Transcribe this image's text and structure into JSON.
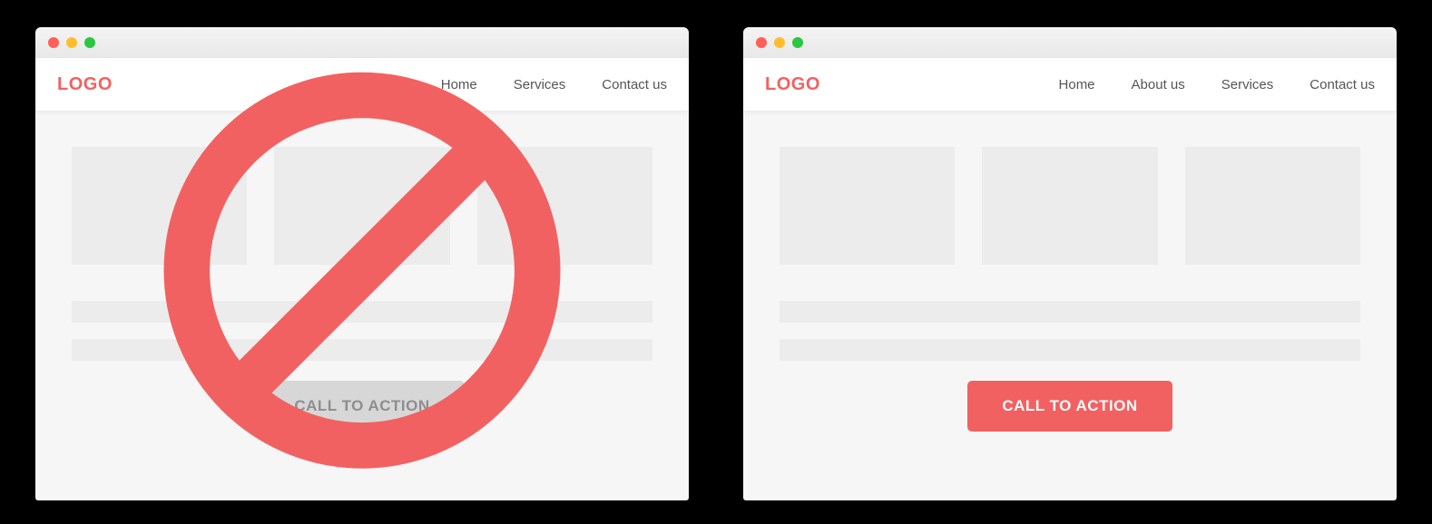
{
  "colors": {
    "accent": "#f26161",
    "muted": "#d7d7d7",
    "page": "#f6f6f6"
  },
  "left": {
    "variant": "bad",
    "logo": "LOGO",
    "nav": [
      "Home",
      "Services",
      "Contact us"
    ],
    "cta": "CALL TO ACTION",
    "overlay": "prohibited"
  },
  "right": {
    "variant": "good",
    "logo": "LOGO",
    "nav": [
      "Home",
      "About us",
      "Services",
      "Contact us"
    ],
    "cta": "CALL TO ACTION"
  }
}
